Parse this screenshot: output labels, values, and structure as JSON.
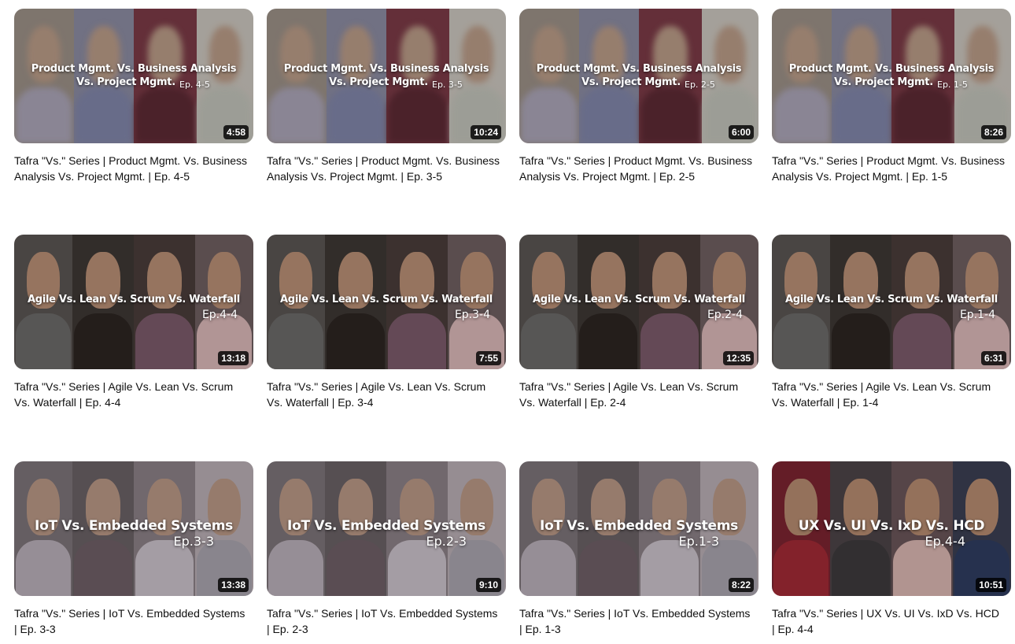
{
  "videos": [
    {
      "overlay_line1": "Product Mgmt. Vs. Business Analysis",
      "overlay_line2": "Vs. Project Mgmt.",
      "overlay_ep": "Ep. 4-5",
      "duration": "4:58",
      "title": "Tafra \"Vs.\" Series | Product Mgmt. Vs. Business Analysis Vs. Project Mgmt. | Ep. 4-5",
      "theme": "blur"
    },
    {
      "overlay_line1": "Product Mgmt. Vs. Business Analysis",
      "overlay_line2": "Vs. Project Mgmt.",
      "overlay_ep": "Ep. 3-5",
      "duration": "10:24",
      "title": "Tafra \"Vs.\" Series | Product Mgmt. Vs. Business Analysis Vs. Project Mgmt. | Ep. 3-5",
      "theme": "blur"
    },
    {
      "overlay_line1": "Product Mgmt. Vs. Business Analysis",
      "overlay_line2": "Vs. Project Mgmt.",
      "overlay_ep": "Ep. 2-5",
      "duration": "6:00",
      "title": "Tafra \"Vs.\" Series | Product Mgmt. Vs. Business Analysis Vs. Project Mgmt. | Ep. 2-5",
      "theme": "blur"
    },
    {
      "overlay_line1": "Product Mgmt. Vs. Business Analysis",
      "overlay_line2": "Vs. Project Mgmt.",
      "overlay_ep": "Ep. 1-5",
      "duration": "8:26",
      "title": "Tafra \"Vs.\" Series | Product Mgmt. Vs. Business Analysis Vs. Project Mgmt. | Ep. 1-5",
      "theme": "blur"
    },
    {
      "overlay_line1": "Agile Vs. Lean Vs. Scrum Vs. Waterfall",
      "overlay_line2": "",
      "overlay_ep": "Ep.4-4",
      "duration": "13:18",
      "title": "Tafra \"Vs.\" Series | Agile Vs. Lean Vs. Scrum Vs. Waterfall | Ep. 4-4",
      "theme": "agile"
    },
    {
      "overlay_line1": "Agile Vs. Lean Vs. Scrum Vs. Waterfall",
      "overlay_line2": "",
      "overlay_ep": "Ep.3-4",
      "duration": "7:55",
      "title": "Tafra \"Vs.\" Series | Agile Vs. Lean Vs. Scrum Vs. Waterfall | Ep. 3-4",
      "theme": "agile"
    },
    {
      "overlay_line1": "Agile Vs. Lean Vs. Scrum Vs. Waterfall",
      "overlay_line2": "",
      "overlay_ep": "Ep.2-4",
      "duration": "12:35",
      "title": "Tafra \"Vs.\" Series | Agile Vs. Lean Vs. Scrum Vs. Waterfall | Ep. 2-4",
      "theme": "agile"
    },
    {
      "overlay_line1": "Agile Vs. Lean Vs. Scrum Vs. Waterfall",
      "overlay_line2": "",
      "overlay_ep": "Ep.1-4",
      "duration": "6:31",
      "title": "Tafra \"Vs.\" Series | Agile Vs. Lean Vs. Scrum Vs. Waterfall | Ep. 1-4",
      "theme": "agile"
    },
    {
      "overlay_line1": "IoT Vs. Embedded Systems",
      "overlay_line2": "",
      "overlay_ep": "Ep.3-3",
      "duration": "13:38",
      "title": "Tafra \"Vs.\" Series | IoT Vs. Embedded Systems | Ep. 3-3",
      "theme": "iot"
    },
    {
      "overlay_line1": "IoT Vs. Embedded Systems",
      "overlay_line2": "",
      "overlay_ep": "Ep.2-3",
      "duration": "9:10",
      "title": "Tafra \"Vs.\" Series | IoT Vs. Embedded Systems | Ep. 2-3",
      "theme": "iot"
    },
    {
      "overlay_line1": "IoT Vs. Embedded Systems",
      "overlay_line2": "",
      "overlay_ep": "Ep.1-3",
      "duration": "8:22",
      "title": "Tafra \"Vs.\" Series | IoT Vs. Embedded Systems | Ep. 1-3",
      "theme": "iot"
    },
    {
      "overlay_line1": "UX Vs. UI Vs. IxD Vs. HCD",
      "overlay_line2": "",
      "overlay_ep": "Ep.4-4",
      "duration": "10:51",
      "title": "Tafra \"Vs.\" Series | UX Vs. UI Vs. IxD Vs. HCD | Ep. 4-4",
      "theme": "ux"
    }
  ],
  "theme_colors": {
    "blur": {
      "strips": [
        "#9a8f86",
        "#8a8aa0",
        "#7a3a46",
        "#c9c4bc"
      ],
      "skin": "#b89a86",
      "body": [
        "#a9a3b5",
        "#7f84a8",
        "#5c2a34",
        "#bfc0b8"
      ]
    },
    "agile": {
      "strips": [
        "#5a5552",
        "#3e3734",
        "#4a3c3a",
        "#6e5e60"
      ],
      "skin": "#b88e74",
      "body": [
        "#6b6a68",
        "#2c2522",
        "#7b5a6a",
        "#d8b6b6"
      ]
    },
    "iot": {
      "strips": [
        "#7c7378",
        "#6a6165",
        "#8a7f86",
        "#b7adb3"
      ],
      "skin": "#b89784",
      "body": [
        "#b8aeb7",
        "#6e5f66",
        "#c9c0c8",
        "#a8a3ad"
      ]
    },
    "ux": {
      "strips": [
        "#7b2430",
        "#4c4447",
        "#6a5558",
        "#3b3f52"
      ],
      "skin": "#b58a70",
      "body": [
        "#a02a35",
        "#3e3a3c",
        "#d8b5b0",
        "#2f3c60"
      ]
    }
  }
}
